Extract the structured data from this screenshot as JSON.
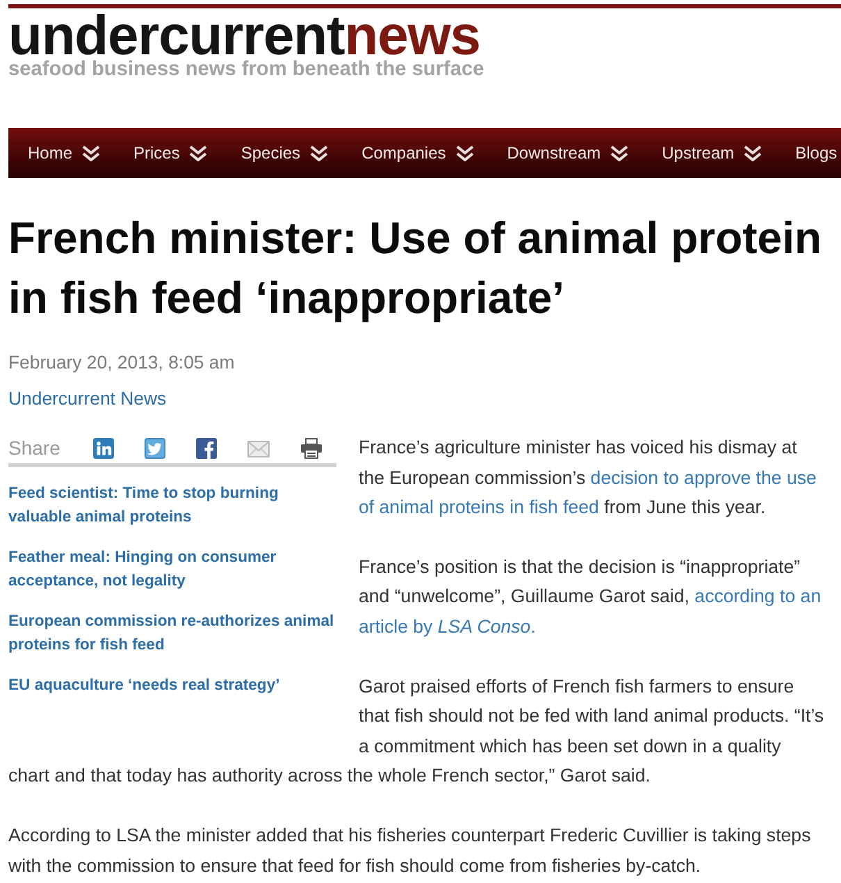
{
  "header": {
    "logo": [
      {
        "text": "undercurrent",
        "kind": "main"
      },
      {
        "text": "news",
        "kind": "accent"
      }
    ],
    "tagline": "seafood business news from beneath the surface"
  },
  "nav": [
    {
      "label": "Home",
      "dropdown": true
    },
    {
      "label": "Prices",
      "dropdown": true
    },
    {
      "label": "Species",
      "dropdown": true
    },
    {
      "label": "Companies",
      "dropdown": true
    },
    {
      "label": "Downstream",
      "dropdown": true
    },
    {
      "label": "Upstream",
      "dropdown": true
    },
    {
      "label": "Blogs",
      "dropdown": false
    }
  ],
  "article": {
    "title": "French minister: Use of animal protein in fish feed ‘inappropriate’",
    "date": "February 20, 2013, 8:05 am",
    "author": "Undercurrent News",
    "share_label": "Share"
  },
  "related": [
    "Feed scientist: Time to stop burning valuable animal proteins",
    "Feather meal: Hinging on consumer acceptance, not legality",
    "European commission re-authorizes animal proteins for fish feed",
    "EU aquaculture ‘needs real strategy’"
  ],
  "paragraphs": [
    [
      {
        "kind": "text",
        "text": "France’s agriculture minister has voiced his dismay at the European commission’s "
      },
      {
        "kind": "link",
        "text": "decision to approve the use"
      },
      {
        "kind": "space"
      },
      {
        "kind": "link",
        "text": "of animal proteins in fish feed"
      },
      {
        "kind": "text",
        "text": " from June this year."
      }
    ],
    [
      {
        "kind": "text",
        "text": "France’s position is that the decision is “inappropriate” and “unwelcome”, Guillaume Garot said, "
      },
      {
        "kind": "link",
        "text": "according to an"
      },
      {
        "kind": "space"
      },
      {
        "kind": "link",
        "text": "article by *LSA Conso*."
      }
    ],
    [
      {
        "kind": "text",
        "text": "Garot praised efforts of French fish farmers to ensure that fish should not be fed with land animal products. “It’s a commitment which has been set down in a quality chart and that today has authority across the whole French sector,” Garot said."
      }
    ],
    [
      {
        "kind": "text",
        "text": "According to LSA the minister added that his fisheries counterpart Frederic Cuvillier is taking steps with the commission to ensure that feed for fish should come from fisheries by-catch."
      }
    ]
  ]
}
